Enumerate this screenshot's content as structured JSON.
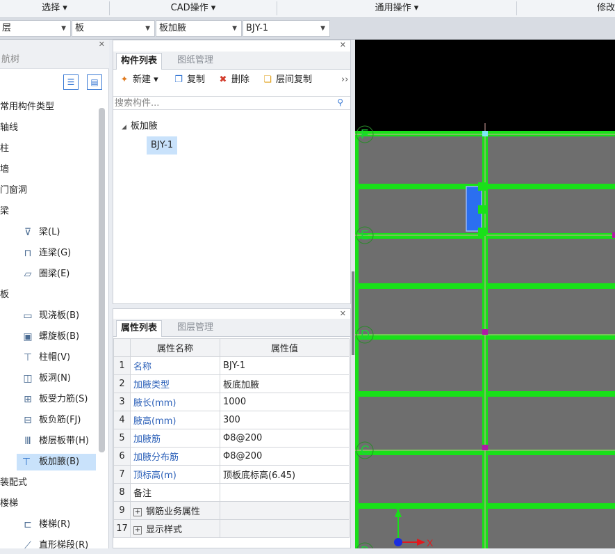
{
  "ribbon": {
    "groups": [
      "选择 ▾",
      "CAD操作 ▾",
      "通用操作 ▾",
      "修改"
    ]
  },
  "selectors": {
    "floor": "层",
    "category": "板",
    "type": "板加腋",
    "component": "BJY-1"
  },
  "nav": {
    "title": "航树",
    "items": [
      {
        "label": "常用构件类型",
        "level": 0,
        "icon": ""
      },
      {
        "label": "轴线",
        "level": 0,
        "icon": ""
      },
      {
        "label": "柱",
        "level": 0,
        "icon": ""
      },
      {
        "label": "墙",
        "level": 0,
        "icon": ""
      },
      {
        "label": "门窗洞",
        "level": 0,
        "icon": ""
      },
      {
        "label": "梁",
        "level": 0,
        "icon": ""
      },
      {
        "label": "梁(L)",
        "level": 1,
        "icon": "beam-icon"
      },
      {
        "label": "连梁(G)",
        "level": 1,
        "icon": "link-beam-icon"
      },
      {
        "label": "圈梁(E)",
        "level": 1,
        "icon": "ring-beam-icon"
      },
      {
        "label": "板",
        "level": 0,
        "icon": ""
      },
      {
        "label": "现浇板(B)",
        "level": 1,
        "icon": "cast-slab-icon"
      },
      {
        "label": "螺旋板(B)",
        "level": 1,
        "icon": "spiral-slab-icon"
      },
      {
        "label": "柱帽(V)",
        "level": 1,
        "icon": "column-cap-icon"
      },
      {
        "label": "板洞(N)",
        "level": 1,
        "icon": "slab-hole-icon"
      },
      {
        "label": "板受力筋(S)",
        "level": 1,
        "icon": "slab-rebar-icon"
      },
      {
        "label": "板负筋(FJ)",
        "level": 1,
        "icon": "slab-negative-rebar-icon"
      },
      {
        "label": "楼层板带(H)",
        "level": 1,
        "icon": "slab-strip-icon"
      },
      {
        "label": "板加腋(B)",
        "level": 1,
        "icon": "slab-haunch-icon",
        "selected": true
      },
      {
        "label": "装配式",
        "level": 0,
        "icon": ""
      },
      {
        "label": "楼梯",
        "level": 0,
        "icon": ""
      },
      {
        "label": "楼梯(R)",
        "level": 1,
        "icon": "stair-icon"
      },
      {
        "label": "直形梯段(R)",
        "level": 1,
        "icon": "straight-stair-icon"
      }
    ]
  },
  "component_panel": {
    "tabs": [
      "构件列表",
      "图纸管理"
    ],
    "toolbar": [
      "新建 ▾",
      "复制",
      "删除",
      "层间复制"
    ],
    "toolbar_more": "››",
    "search_placeholder": "搜索构件...",
    "tree_parent": "板加腋",
    "tree_child": "BJY-1"
  },
  "property_panel": {
    "tabs": [
      "属性列表",
      "图层管理"
    ],
    "header_name": "属性名称",
    "header_value": "属性值",
    "rows": [
      {
        "idx": "1",
        "name": "名称",
        "value": "BJY-1"
      },
      {
        "idx": "2",
        "name": "加腋类型",
        "value": "板底加腋"
      },
      {
        "idx": "3",
        "name": "腋长(mm)",
        "value": "1000"
      },
      {
        "idx": "4",
        "name": "腋高(mm)",
        "value": "300"
      },
      {
        "idx": "5",
        "name": "加腋筋",
        "value": "Φ8@200"
      },
      {
        "idx": "6",
        "name": "加腋分布筋",
        "value": "Φ8@200"
      },
      {
        "idx": "7",
        "name": "顶标高(m)",
        "value": "顶板底标高(6.45)"
      },
      {
        "idx": "8",
        "name": "备注",
        "value": ""
      },
      {
        "idx": "9",
        "name": "钢筋业务属性",
        "value": "",
        "group": true
      },
      {
        "idx": "17",
        "name": "显示样式",
        "value": "",
        "group": true
      }
    ]
  },
  "canvas": {
    "axis_labels": [
      "F",
      "E",
      "D",
      "C",
      "B"
    ],
    "coord_x": "X",
    "coord_y": "Y",
    "colors": {
      "background": "#000000",
      "slab": "#6e6e6e",
      "beam": "#19e019",
      "axis_line": "#d9a5a0",
      "haunch": "#2b6ff0",
      "axis_label": "#1fcf3c",
      "ucs_x": "#e0191e",
      "ucs_y": "#19e019"
    }
  }
}
